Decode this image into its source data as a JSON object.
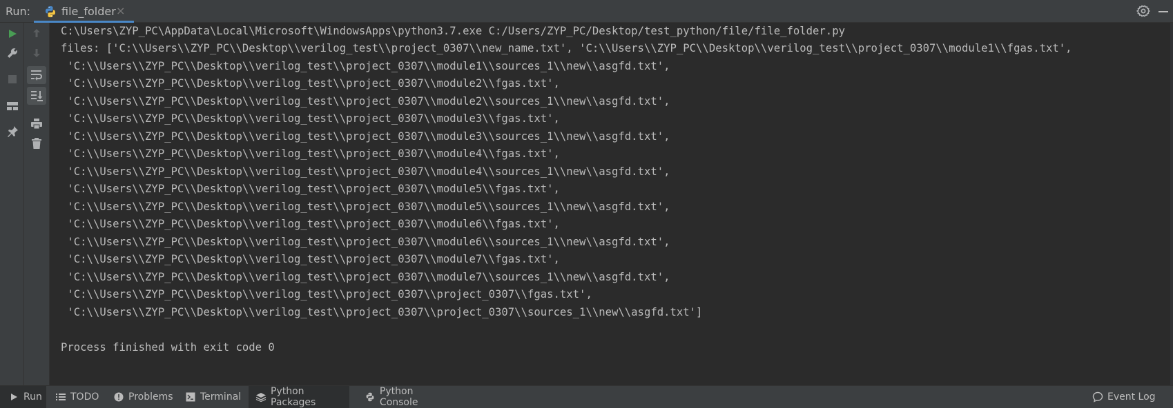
{
  "header": {
    "run_label": "Run:",
    "tab_label": "file_folder",
    "tab_close": "×"
  },
  "console": {
    "lines": [
      "C:\\Users\\ZYP_PC\\AppData\\Local\\Microsoft\\WindowsApps\\python3.7.exe C:/Users/ZYP_PC/Desktop/test_python/file/file_folder.py",
      "files: ['C:\\\\Users\\\\ZYP_PC\\\\Desktop\\\\verilog_test\\\\project_0307\\\\new_name.txt', 'C:\\\\Users\\\\ZYP_PC\\\\Desktop\\\\verilog_test\\\\project_0307\\\\module1\\\\fgas.txt',",
      " 'C:\\\\Users\\\\ZYP_PC\\\\Desktop\\\\verilog_test\\\\project_0307\\\\module1\\\\sources_1\\\\new\\\\asgfd.txt',",
      " 'C:\\\\Users\\\\ZYP_PC\\\\Desktop\\\\verilog_test\\\\project_0307\\\\module2\\\\fgas.txt',",
      " 'C:\\\\Users\\\\ZYP_PC\\\\Desktop\\\\verilog_test\\\\project_0307\\\\module2\\\\sources_1\\\\new\\\\asgfd.txt',",
      " 'C:\\\\Users\\\\ZYP_PC\\\\Desktop\\\\verilog_test\\\\project_0307\\\\module3\\\\fgas.txt',",
      " 'C:\\\\Users\\\\ZYP_PC\\\\Desktop\\\\verilog_test\\\\project_0307\\\\module3\\\\sources_1\\\\new\\\\asgfd.txt',",
      " 'C:\\\\Users\\\\ZYP_PC\\\\Desktop\\\\verilog_test\\\\project_0307\\\\module4\\\\fgas.txt',",
      " 'C:\\\\Users\\\\ZYP_PC\\\\Desktop\\\\verilog_test\\\\project_0307\\\\module4\\\\sources_1\\\\new\\\\asgfd.txt',",
      " 'C:\\\\Users\\\\ZYP_PC\\\\Desktop\\\\verilog_test\\\\project_0307\\\\module5\\\\fgas.txt',",
      " 'C:\\\\Users\\\\ZYP_PC\\\\Desktop\\\\verilog_test\\\\project_0307\\\\module5\\\\sources_1\\\\new\\\\asgfd.txt',",
      " 'C:\\\\Users\\\\ZYP_PC\\\\Desktop\\\\verilog_test\\\\project_0307\\\\module6\\\\fgas.txt',",
      " 'C:\\\\Users\\\\ZYP_PC\\\\Desktop\\\\verilog_test\\\\project_0307\\\\module6\\\\sources_1\\\\new\\\\asgfd.txt',",
      " 'C:\\\\Users\\\\ZYP_PC\\\\Desktop\\\\verilog_test\\\\project_0307\\\\module7\\\\fgas.txt',",
      " 'C:\\\\Users\\\\ZYP_PC\\\\Desktop\\\\verilog_test\\\\project_0307\\\\module7\\\\sources_1\\\\new\\\\asgfd.txt',",
      " 'C:\\\\Users\\\\ZYP_PC\\\\Desktop\\\\verilog_test\\\\project_0307\\\\project_0307\\\\fgas.txt',",
      " 'C:\\\\Users\\\\ZYP_PC\\\\Desktop\\\\verilog_test\\\\project_0307\\\\project_0307\\\\sources_1\\\\new\\\\asgfd.txt']",
      "",
      "Process finished with exit code 0"
    ]
  },
  "bottom_bar": {
    "run": "Run",
    "todo": "TODO",
    "problems": "Problems",
    "terminal": "Terminal",
    "python_packages": "Python Packages",
    "python_console": "Python Console",
    "event_log": "Event Log"
  },
  "icons": {
    "run_tab": "run-icon",
    "todo": "list-icon",
    "problems": "warning-icon",
    "terminal": "terminal-icon",
    "python_packages": "layers-icon",
    "python_console": "python-icon",
    "event_log": "speech-bubble-icon"
  },
  "colors": {
    "accent": "#4a88c7",
    "run_green": "#499c54",
    "background": "#2b2b2b",
    "panel": "#3c3f41",
    "text": "#bbbbbb"
  }
}
